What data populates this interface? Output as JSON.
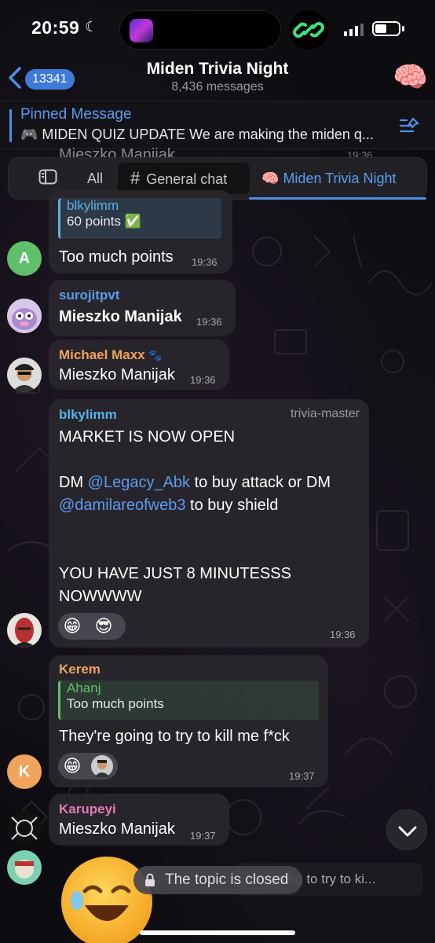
{
  "status_bar": {
    "time": "20:59",
    "moon_icon": "moon-icon"
  },
  "header": {
    "back_count": "13341",
    "title": "Miden Trivia Night",
    "subtitle": "8,436 messages",
    "avatar_emoji": "🧠"
  },
  "pinned": {
    "title": "Pinned Message",
    "text": "🎮 MIDEN QUIZ UPDATE We are making the miden q..."
  },
  "peek": {
    "name": "Mieszko Manijak",
    "time": "19:36"
  },
  "tabs": {
    "all": "All",
    "general": "General chat",
    "general_icon": "#",
    "miden": "Miden Trivia Night",
    "miden_icon": "🧠"
  },
  "messages": [
    {
      "reply_name": "blkylimm",
      "reply_text": "60 points ✅",
      "text": "Too much points",
      "time": "19:36",
      "avatar_letter": "A",
      "avatar_color": "#5fbf6a"
    },
    {
      "name": "surojitpvt",
      "name_color": "#5a9cf0",
      "text": "Mieszko Manijak",
      "time": "19:36"
    },
    {
      "name": "Michael Maxx",
      "name_badge": "🐾",
      "name_color": "#f0a35a",
      "text": "Mieszko Manijak",
      "time": "19:36"
    },
    {
      "name": "blkylimm",
      "name_color": "#5ab0e8",
      "role": "trivia-master",
      "line1": "MARKET IS NOW OPEN",
      "line2a": "DM ",
      "mention1": "@Legacy_Abk",
      "line2b": " to buy attack or DM",
      "mention2": "@damilareofweb3",
      "line3b": " to buy shield",
      "line4": "YOU HAVE JUST 8 MINUTESSS",
      "line5": "NOWWWW",
      "reactions": [
        "😁",
        "😎"
      ],
      "time": "19:36"
    },
    {
      "name": "Kerem",
      "name_color": "#f0a35a",
      "reply_name": "Ahanj",
      "reply_text": "Too much points",
      "text": "They're going to try to kill me f*ck",
      "reactions": [
        "😁"
      ],
      "time": "19:37",
      "avatar_letter": "K",
      "avatar_color": "#f0a35a"
    },
    {
      "name": "Karupeyi",
      "name_color": "#e07ab8",
      "text": "Mieszko Manijak",
      "time": "19:37"
    }
  ],
  "bottom": {
    "closed_text": "The topic is closed",
    "draft_text": "going to try to ki..."
  }
}
